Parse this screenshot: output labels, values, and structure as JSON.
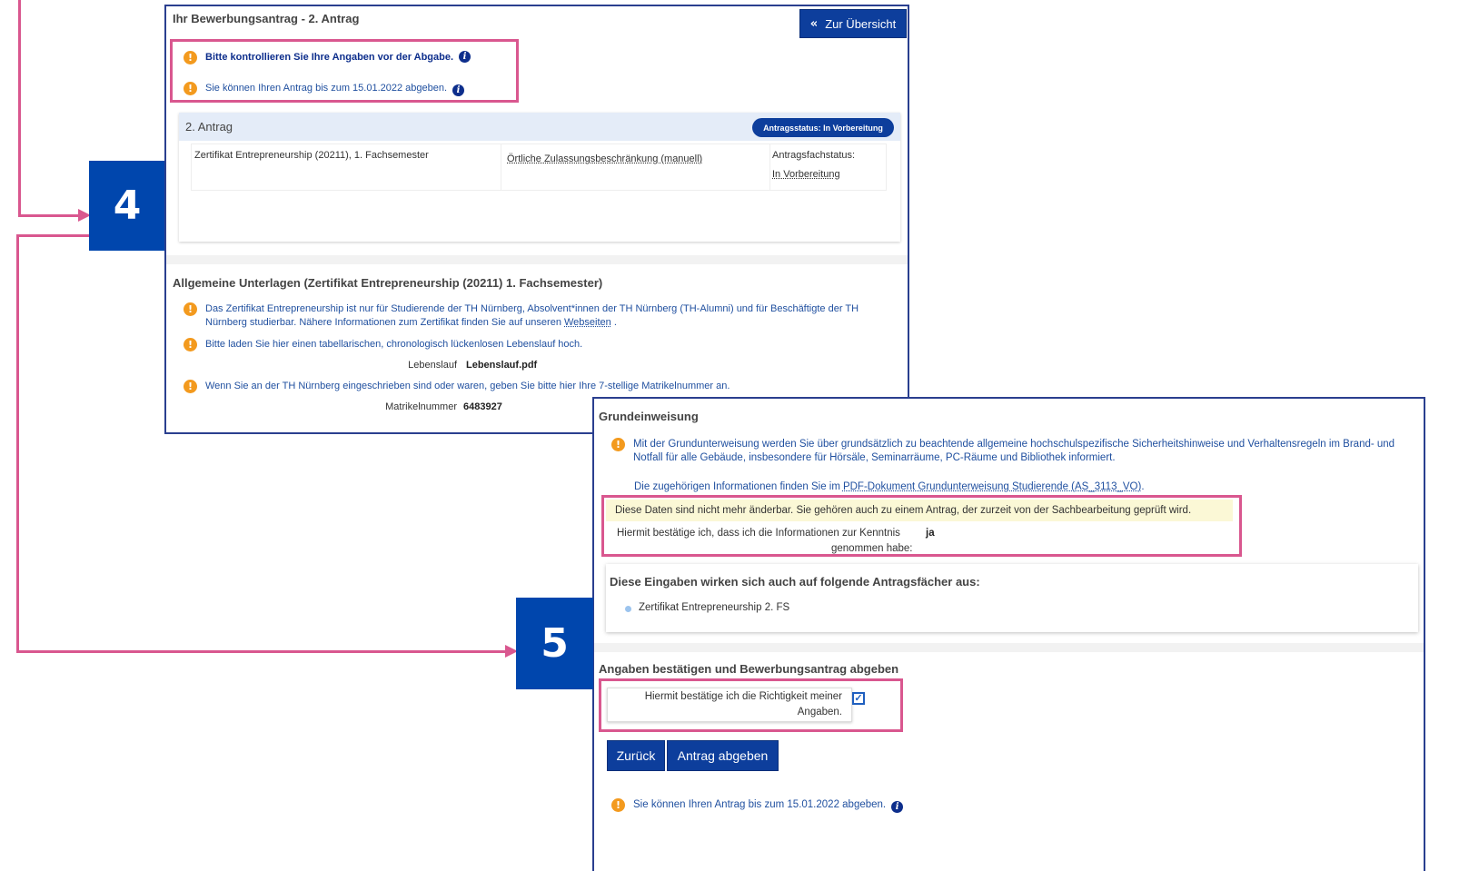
{
  "colors": {
    "accent_blue": "#0d3e9c",
    "highlight_pink": "#d9578f",
    "warning_orange": "#f39a1e",
    "link_blue": "#1f4f9f",
    "note_yellow": "#fbf8d6"
  },
  "steps": {
    "step4": "4",
    "step5": "5"
  },
  "panel1": {
    "title": "Ihr Bewerbungsantrag - 2. Antrag",
    "overview_button": "Zur Übersicht",
    "notice1": "Bitte kontrollieren Sie Ihre Angaben vor der Abgabe.",
    "notice2": "Sie können Ihren Antrag bis zum 15.01.2022 abgeben.",
    "antrag": {
      "title": "2. Antrag",
      "status_pill": "Antragsstatus: In Vorbereitung",
      "subject": "Zertifikat Entrepreneurship (20211), 1. Fachsemester",
      "restriction": "Örtliche Zulassungsbeschränkung (manuell)",
      "subject_status_label": "Antragsfachstatus:",
      "subject_status_value": "In Vorbereitung"
    },
    "general": {
      "title": "Allgemeine Unterlagen (Zertifikat Entrepreneurship (20211) 1. Fachsemester)",
      "info1_part1": "Das Zertifikat Entrepreneurship ist nur für Studierende der TH Nürnberg, Absolvent*innen der TH Nürnberg (TH-Alumni) und für Beschäftigte der TH Nürnberg studierbar. Nähere Informationen zum Zertifikat finden Sie auf unseren ",
      "info1_link": "Webseiten",
      "info1_end": " .",
      "info2": "Bitte laden Sie hier einen tabellarischen, chronologisch lückenlosen Lebenslauf hoch.",
      "cv_label": "Lebenslauf",
      "cv_value": "Lebenslauf.pdf",
      "info3": "Wenn Sie an der TH Nürnberg eingeschrieben sind oder waren, geben Sie bitte hier Ihre 7-stellige Matrikelnummer an.",
      "matrikel_label": "Matrikelnummer",
      "matrikel_value": "6483927"
    }
  },
  "panel2": {
    "title": "Grundeinweisung",
    "info1": "Mit der Grundunterweisung werden Sie über grundsätzlich zu beachtende allgemeine hochschulspezifische Sicherheitshinweise und Verhaltensregeln im Brand- und Notfall für alle Gebäude, insbesondere für Hörsäle, Seminarräume, PC-Räume und Bibliothek informiert.",
    "pdf_prefix": "Die zugehörigen Informationen finden Sie im ",
    "pdf_link": "PDF-Dokument Grundunterweisung Studierende (AS_3113_VO)",
    "pdf_suffix": " .",
    "locked_note": "Diese Daten sind nicht mehr änderbar. Sie gehören auch zu einem Antrag, der zurzeit von der Sachbearbeitung geprüft wird.",
    "confirm_label_1": "Hiermit bestätige ich, dass ich die Informationen zur Kenntnis",
    "confirm_label_2": "genommen habe:",
    "confirm_value": "ja",
    "affects_title": "Diese Eingaben wirken sich auch auf folgende Antragsfächer aus:",
    "affects_item": "Zertifikat Entrepreneurship 2. FS",
    "submit_title": "Angaben bestätigen und Bewerbungsantrag abgeben",
    "accuracy_label_1": "Hiermit bestätige ich die Richtigkeit meiner",
    "accuracy_label_2": "Angaben.",
    "back_button": "Zurück",
    "submit_button": "Antrag abgeben",
    "deadline": "Sie können Ihren Antrag bis zum 15.01.2022 abgeben."
  }
}
